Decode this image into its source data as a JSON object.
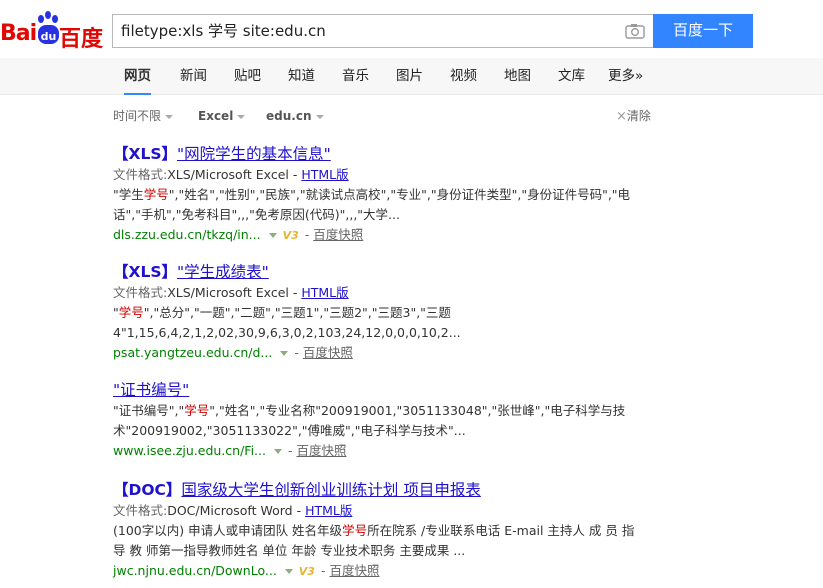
{
  "logo": {
    "left_text": "Bai",
    "right_text": "百度"
  },
  "search": {
    "value": "filetype:xls 学号 site:edu.cn",
    "button": "百度一下"
  },
  "tabs": [
    "网页",
    "新闻",
    "贴吧",
    "知道",
    "音乐",
    "图片",
    "视频",
    "地图",
    "文库",
    "更多»"
  ],
  "filters": {
    "time": "时间不限",
    "type": "Excel",
    "site": "edu.cn",
    "clear": "清除"
  },
  "results": [
    {
      "tag": "【XLS】",
      "title": "\"网院学生的基本信息\"",
      "format_label": "文件格式:",
      "format_value": "XLS/Microsoft Excel - ",
      "html_link": "HTML版",
      "abstract_1a": "\"学生",
      "abstract_1em": "学号",
      "abstract_1b": "\",\"姓名\",\"性别\",\"民族\",\"就读试点高校\",\"专业\",\"身份证件类型\",\"身份证件号码\",\"电",
      "abstract_2": "话\",\"手机\",\"免考科目\",,,\"免考原因(代码)\",,,\"大学...",
      "url": "dls.zzu.edu.cn/tkzq/in...",
      "has_v3": true,
      "snapshot": "百度快照"
    },
    {
      "tag": "【XLS】",
      "title": "\"学生成绩表\"",
      "format_label": "文件格式:",
      "format_value": "XLS/Microsoft Excel - ",
      "html_link": "HTML版",
      "abstract_1a": "\"",
      "abstract_1em": "学号",
      "abstract_1b": "\",\"总分\",\"一题\",\"二题\",\"三题1\",\"三题2\",\"三题3\",\"三题",
      "abstract_2": "4\"1,15,6,4,2,1,2,02,30,9,6,3,0,2,103,24,12,0,0,0,10,2...",
      "url": "psat.yangtzeu.edu.cn/d...",
      "has_v3": false,
      "snapshot": "百度快照"
    },
    {
      "tag": "",
      "title": "\"证书编号\"",
      "abstract_1a": "\"证书编号\",\"",
      "abstract_1em": "学号",
      "abstract_1b": "\",\"姓名\",\"专业名称\"200919001,\"3051133048\",\"张世峰\",\"电子科学与技",
      "abstract_2": "术\"200919002,\"3051133022\",\"傅唯威\",\"电子科学与技术\"...",
      "url": "www.isee.zju.edu.cn/Fi...",
      "has_v3": false,
      "snapshot": "百度快照"
    },
    {
      "tag": "【DOC】",
      "title": "国家级大学生创新创业训练计划 项目申报表",
      "format_label": "文件格式:",
      "format_value": "DOC/Microsoft Word - ",
      "html_link": "HTML版",
      "abstract_1a": "(100字以内) 申请人或申请团队 姓名年级",
      "abstract_1em": "学号",
      "abstract_1b": "所在院系 /专业联系电话 E-mail 主持人 成 员 指",
      "abstract_2": "导 教 师第一指导教师姓名 单位 年龄 专业技术职务 主要成果 ...",
      "url": "jwc.njnu.edu.cn/DownLo...",
      "has_v3": true,
      "snapshot": "百度快照"
    }
  ],
  "v3_label": "V3",
  "dash": "-",
  "colors": {
    "brand_red": "#e10602",
    "brand_blue": "#2932e1",
    "search_button": "#3385ff",
    "link": "#2011cc",
    "url_green": "#008000",
    "highlight": "#c00000"
  }
}
